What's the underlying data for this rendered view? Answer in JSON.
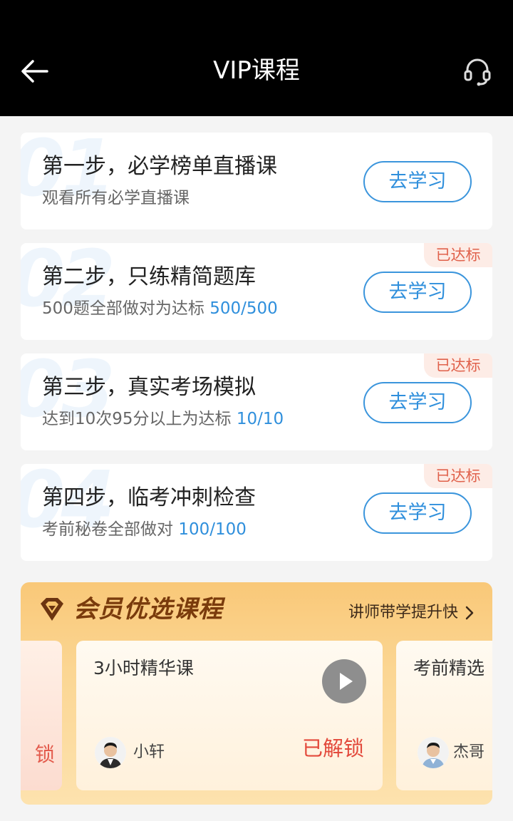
{
  "header": {
    "title": "VIP课程",
    "back_icon": "back-arrow-icon",
    "support_icon": "headset-icon"
  },
  "steps": [
    {
      "num": "01",
      "title": "第一步，必学榜单直播课",
      "desc": "观看所有必学直播课",
      "progress": "",
      "button": "去学习",
      "badge": ""
    },
    {
      "num": "02",
      "title": "第二步，只练精简题库",
      "desc": "500题全部做对为达标 ",
      "progress": "500/500",
      "button": "去学习",
      "badge": "已达标"
    },
    {
      "num": "03",
      "title": "第三步，真实考场模拟",
      "desc": "达到10次95分以上为达标 ",
      "progress": "10/10",
      "button": "去学习",
      "badge": "已达标"
    },
    {
      "num": "04",
      "title": "第四步，临考冲刺检查",
      "desc": "考前秘卷全部做对 ",
      "progress": "100/100",
      "button": "去学习",
      "badge": "已达标"
    }
  ],
  "vip": {
    "title": "会员优选课程",
    "link": "讲师带学提升快",
    "prev_card": {
      "status": "锁"
    },
    "courses": [
      {
        "name": "3小时精华课",
        "teacher": "小轩",
        "status": "已解锁"
      },
      {
        "name": "考前精选",
        "teacher": "杰哥"
      }
    ]
  },
  "colors": {
    "accent": "#2f8fdc",
    "badge_text": "#e0614b",
    "unlock_red": "#e34a3c",
    "vip_gold": "#f9c878"
  }
}
